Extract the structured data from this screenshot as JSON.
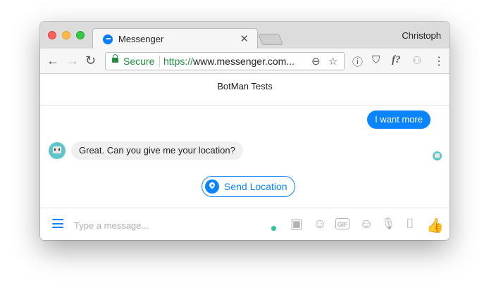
{
  "browser": {
    "profile_name": "Christoph",
    "tab": {
      "title": "Messenger",
      "close_glyph": "✕"
    },
    "nav": {
      "back_glyph": "←",
      "forward_glyph": "→",
      "reload_glyph": "↻",
      "menu_glyph": "⋮"
    },
    "address": {
      "secure_label": "Secure",
      "url_scheme": "https://",
      "url_rest": "www.messenger.com...",
      "zoom_glyph": "⊖",
      "star_glyph": "☆"
    },
    "extensions": [
      {
        "icon": "onepassword-icon",
        "glyph": "ⓘ"
      },
      {
        "icon": "pocket-icon",
        "glyph": "⛉"
      },
      {
        "icon": "f-question-icon",
        "glyph": "f?"
      },
      {
        "icon": "badge-icon",
        "glyph": "⚇"
      }
    ]
  },
  "chat": {
    "title": "BotMan Tests",
    "messages": [
      {
        "direction": "outgoing",
        "text": "I want more"
      },
      {
        "direction": "incoming",
        "text": "Great. Can you give me your location?"
      }
    ],
    "quick_reply": {
      "label": "Send Location",
      "icon": "location-pin-icon"
    }
  },
  "composer": {
    "placeholder": "Type a message...",
    "icons": [
      {
        "name": "image-icon",
        "glyph": "▣"
      },
      {
        "name": "sticker-icon",
        "glyph": "☺"
      },
      {
        "name": "gif-icon",
        "label": "GIF"
      },
      {
        "name": "emoji-icon",
        "glyph": "☺"
      },
      {
        "name": "microphone-icon",
        "glyph": "🎙"
      },
      {
        "name": "camera-icon",
        "glyph": "⌷"
      },
      {
        "name": "thumbs-up-icon",
        "glyph": "👍"
      }
    ],
    "accent_color": "#0a84ff"
  }
}
